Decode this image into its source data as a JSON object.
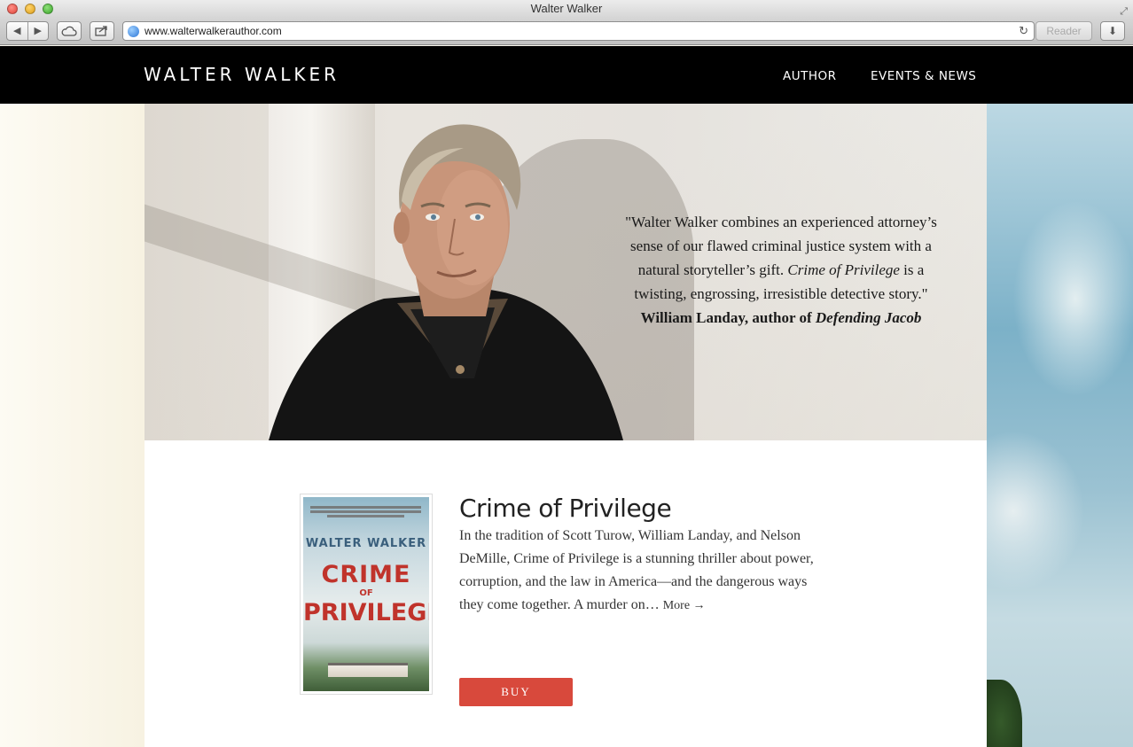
{
  "window": {
    "title": "Walter Walker"
  },
  "browser": {
    "url": "www.walterwalkerauthor.com",
    "reader_label": "Reader",
    "back_glyph": "◀",
    "forward_glyph": "▶",
    "reload_glyph": "↻",
    "download_glyph": "⬇"
  },
  "site": {
    "brand": "WALTER WALKER",
    "nav": [
      {
        "label": "AUTHOR"
      },
      {
        "label": "EVENTS & NEWS"
      }
    ]
  },
  "hero": {
    "quote_part1": "\"Walter Walker combines an experienced attorney’s sense of our flawed criminal justice system with a natural storyteller’s gift.",
    "quote_book": "Crime of Privilege",
    "quote_part2": "is a twisting, engrossing, irresistible detective story.\"",
    "attribution_prefix": "William Landay, author of",
    "attribution_book": "Defending Jacob"
  },
  "book": {
    "title": "Crime of Privilege",
    "description": "In the tradition of Scott Turow, William Landay, and Nelson DeMille, Crime of Privilege is a stunning thriller about power, corruption, and the law in America—and the dangerous ways they come together. A murder on…",
    "more_label": "More →",
    "buy_label": "BUY",
    "cover": {
      "author": "WALTER WALKER",
      "title_line1": "CRIME",
      "title_of": "OF",
      "title_line2": "PRIVILEGE"
    }
  },
  "colors": {
    "nav_bg": "#000000",
    "buy_button": "#d8493c",
    "cover_title": "#c0332b",
    "cover_author": "#3a5f7c"
  }
}
